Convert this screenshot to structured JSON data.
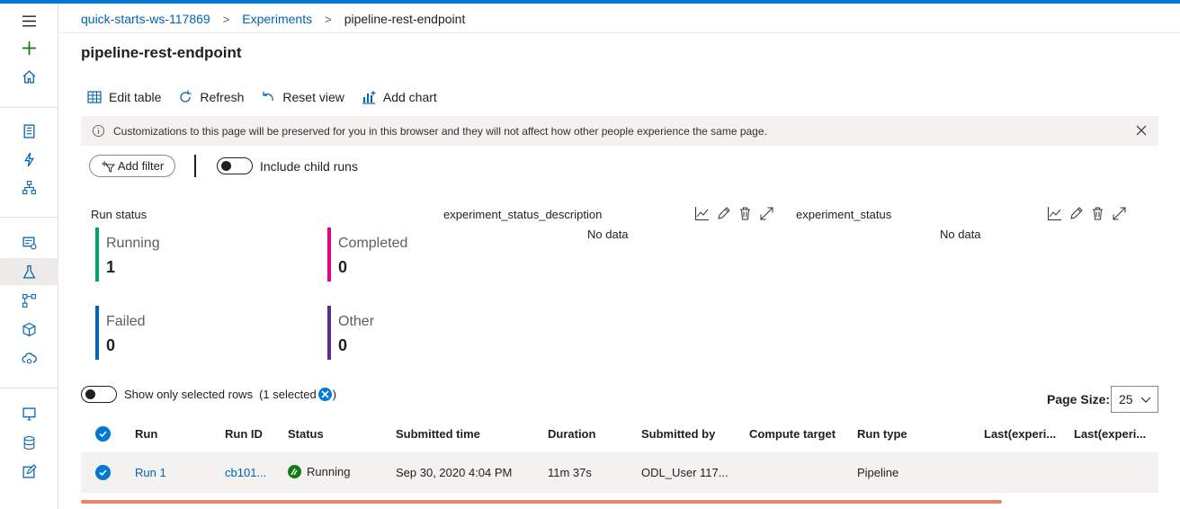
{
  "breadcrumb": {
    "workspace": "quick-starts-ws-117869",
    "experiments": "Experiments",
    "current": "pipeline-rest-endpoint",
    "separator": ">"
  },
  "page_title": "pipeline-rest-endpoint",
  "toolbar": {
    "edit_table": "Edit table",
    "refresh": "Refresh",
    "reset_view": "Reset view",
    "add_chart": "Add chart"
  },
  "banner": {
    "text": "Customizations to this page will be preserved for you in this browser and they will not affect how other people experience the same page."
  },
  "filter": {
    "add_filter": "Add filter",
    "include_child_runs": "Include child runs"
  },
  "run_status": {
    "title": "Run status",
    "tiles": [
      {
        "label": "Running",
        "value": "1",
        "color": "#00a36f"
      },
      {
        "label": "Completed",
        "value": "0",
        "color": "#e3008c"
      },
      {
        "label": "Failed",
        "value": "0",
        "color": "#0063b1"
      },
      {
        "label": "Other",
        "value": "0",
        "color": "#5c2d91"
      }
    ]
  },
  "charts": [
    {
      "title": "experiment_status_description",
      "no_data": "No data"
    },
    {
      "title": "experiment_status",
      "no_data": "No data"
    }
  ],
  "selection": {
    "show_selected": "Show only selected rows",
    "selected_prefix": "(1 selected",
    "selected_suffix": ")"
  },
  "page_size": {
    "label": "Page Size:",
    "value": "25"
  },
  "table": {
    "columns": [
      "Run",
      "Run ID",
      "Status",
      "Submitted time",
      "Duration",
      "Submitted by",
      "Compute target",
      "Run type",
      "Last(experi...",
      "Last(experi..."
    ],
    "rows": [
      {
        "run": "Run 1",
        "run_id": "cb101...",
        "status": "Running",
        "submitted_time": "Sep 30, 2020 4:04 PM",
        "duration": "11m 37s",
        "submitted_by": "ODL_User 117...",
        "compute_target": "",
        "run_type": "Pipeline",
        "last1": "",
        "last2": ""
      }
    ]
  },
  "colors": {
    "accent": "#0078d4",
    "link": "#0063b1",
    "running": "#107c10",
    "scrollbar": "#e8846c"
  }
}
